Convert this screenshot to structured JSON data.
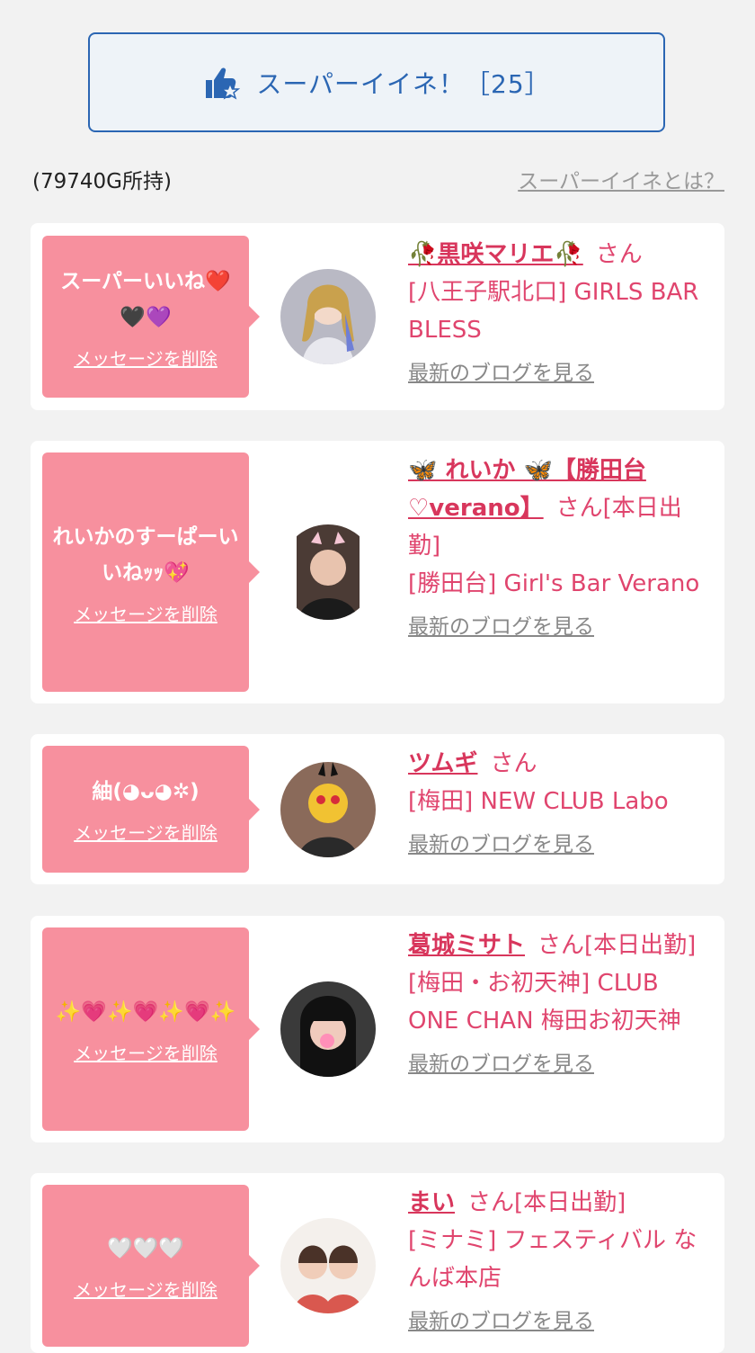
{
  "super_like": {
    "label": "スーパーイイネ！［25］"
  },
  "points_text": "(79740G所持)",
  "about_link": "スーパーイイネとは？",
  "delete_label": "メッセージを削除",
  "san": "さん",
  "blog_label": "最新のブログを見る",
  "cards": [
    {
      "message": "スーパーいいね❤️🖤💜",
      "name": "🥀黒咲マリエ🥀",
      "status": "",
      "shop": "[八王子駅北口] GIRLS BAR BLESS"
    },
    {
      "message": "れいかのすーぱーいいねｯｯ💖",
      "name": "🦋 れいか 🦋【勝田台♡verano】",
      "status": "[本日出勤]",
      "shop": "[勝田台] Girl's Bar Verano"
    },
    {
      "message": "紬(◕ᴗ◕✲)",
      "name": "ツムギ",
      "status": "",
      "shop": "[梅田] NEW CLUB Labo"
    },
    {
      "message": "✨💗✨💗✨💗✨",
      "name": "葛城ミサト",
      "status": "[本日出勤]",
      "shop": "[梅田・お初天神] CLUB ONE CHAN 梅田お初天神"
    },
    {
      "message": "🤍🤍🤍",
      "name": "まい",
      "status": "[本日出勤]",
      "shop": "[ミナミ] フェスティバル なんば本店"
    }
  ],
  "colors": {
    "accent_blue": "#2b66b3",
    "bubble_pink": "#f7909e",
    "name_red": "#d8365c"
  }
}
